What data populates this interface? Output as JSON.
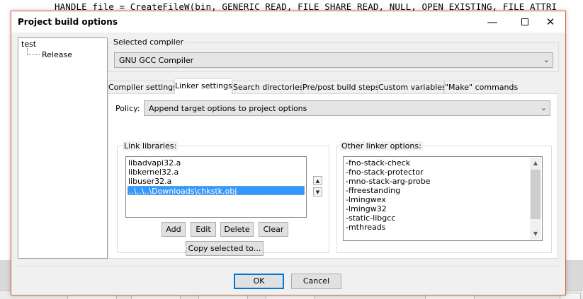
{
  "editor": {
    "code_line": "HANDLE file = CreateFileW(bin, GENERIC_READ, FILE_SHARE_READ, NULL, OPEN_EXISTING, FILE_ATTRI"
  },
  "dialog": {
    "title": "Project build options",
    "window_controls": {
      "minimize_icon": "minimize-icon",
      "maximize_icon": "maximize-icon",
      "close_icon": "close-icon"
    },
    "tree": {
      "root": "test",
      "children": [
        "Release"
      ]
    },
    "compiler_group_label": "Selected compiler",
    "compiler_value": "GNU GCC Compiler",
    "tabs": [
      {
        "label": "Compiler settings"
      },
      {
        "label": "Linker settings"
      },
      {
        "label": "Search directories"
      },
      {
        "label": "Pre/post build steps"
      },
      {
        "label": "Custom variables"
      },
      {
        "label": "\"Make\" commands"
      }
    ],
    "active_tab": "Linker settings",
    "policy_label": "Policy:",
    "policy_value": "Append target options to project options",
    "link_libraries": {
      "label": "Link libraries:",
      "items": [
        "libadvapi32.a",
        "libkernel32.a",
        "libuser32.a",
        "..\\..\\..\\Downloads\\chkstk.obj"
      ],
      "selected": "..\\..\\..\\Downloads\\chkstk.obj",
      "buttons": {
        "add": "Add",
        "edit": "Edit",
        "delete": "Delete",
        "clear": "Clear",
        "copy": "Copy selected to..."
      }
    },
    "other_linker_options": {
      "label": "Other linker options:",
      "lines": [
        "-fno-stack-check",
        "-fno-stack-protector",
        "-mno-stack-arg-probe",
        "-ffreestanding",
        "-lmingwex",
        "-lmingw32",
        "-static-libgcc",
        "-mthreads"
      ]
    },
    "buttons": {
      "ok": "OK",
      "cancel": "Cancel"
    }
  },
  "colors": {
    "selection": "#3399ff",
    "dialog_border": "#d75c3d",
    "default_button_border": "#0078d7"
  }
}
